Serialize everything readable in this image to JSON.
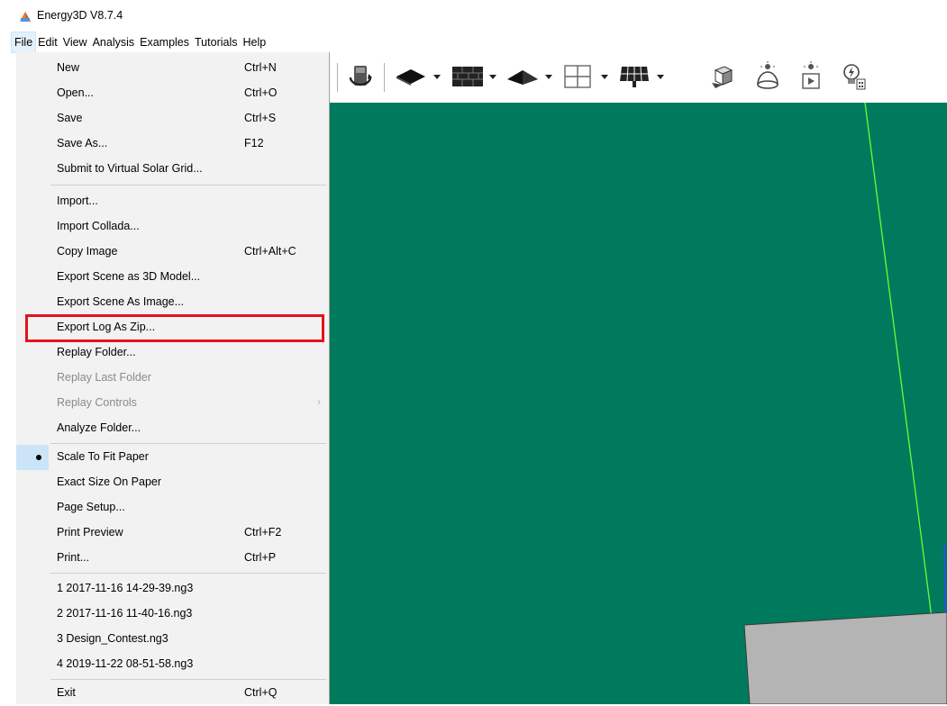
{
  "window": {
    "title": "Energy3D V8.7.4"
  },
  "menubar": {
    "items": [
      {
        "label": "File"
      },
      {
        "label": "Edit"
      },
      {
        "label": "View"
      },
      {
        "label": "Analysis"
      },
      {
        "label": "Examples"
      },
      {
        "label": "Tutorials"
      },
      {
        "label": "Help"
      }
    ]
  },
  "file_menu": {
    "items": [
      {
        "label": "New",
        "accel": "Ctrl+N"
      },
      {
        "label": "Open...",
        "accel": "Ctrl+O"
      },
      {
        "label": "Save",
        "accel": "Ctrl+S"
      },
      {
        "label": "Save As...",
        "accel": "F12"
      },
      {
        "label": "Submit to Virtual Solar Grid...",
        "accel": ""
      },
      {
        "label": "Import...",
        "accel": ""
      },
      {
        "label": "Import Collada...",
        "accel": ""
      },
      {
        "label": "Copy Image",
        "accel": "Ctrl+Alt+C"
      },
      {
        "label": "Export Scene as 3D Model...",
        "accel": ""
      },
      {
        "label": "Export Scene As Image...",
        "accel": ""
      },
      {
        "label": "Export Log As Zip...",
        "accel": "",
        "highlighted": true
      },
      {
        "label": "Replay Folder...",
        "accel": ""
      },
      {
        "label": "Replay Last Folder",
        "accel": "",
        "disabled": true
      },
      {
        "label": "Replay Controls",
        "accel": "",
        "disabled": true,
        "submenu": true
      },
      {
        "label": "Analyze Folder...",
        "accel": ""
      },
      {
        "label": "Scale To Fit Paper",
        "accel": "",
        "selected": true
      },
      {
        "label": "Exact Size On Paper",
        "accel": ""
      },
      {
        "label": "Page Setup...",
        "accel": ""
      },
      {
        "label": "Print Preview",
        "accel": "Ctrl+F2"
      },
      {
        "label": "Print...",
        "accel": "Ctrl+P"
      },
      {
        "label": "1 2017-11-16 14-29-39.ng3",
        "accel": ""
      },
      {
        "label": "2 2017-11-16 11-40-16.ng3",
        "accel": ""
      },
      {
        "label": "3 Design_Contest.ng3",
        "accel": ""
      },
      {
        "label": "4 2019-11-22 08-51-58.ng3",
        "accel": ""
      },
      {
        "label": "Exit",
        "accel": "Ctrl+Q"
      }
    ],
    "submenu_arrow": "›"
  },
  "toolbar": {
    "icons": [
      "rotate-view-icon",
      "foundation-icon",
      "wall-icon",
      "roof-icon",
      "window-icon",
      "solar-panel-icon",
      "shadow-icon",
      "sun-heliodon-icon",
      "sun-animation-icon",
      "energy-analysis-icon"
    ]
  },
  "colors": {
    "scene_ground": "#007a5c",
    "highlight_box": "#e3131b",
    "menu_background": "#f2f2f2",
    "sun_lines": "#66ff33",
    "building_gray": "#b4b4b4"
  }
}
